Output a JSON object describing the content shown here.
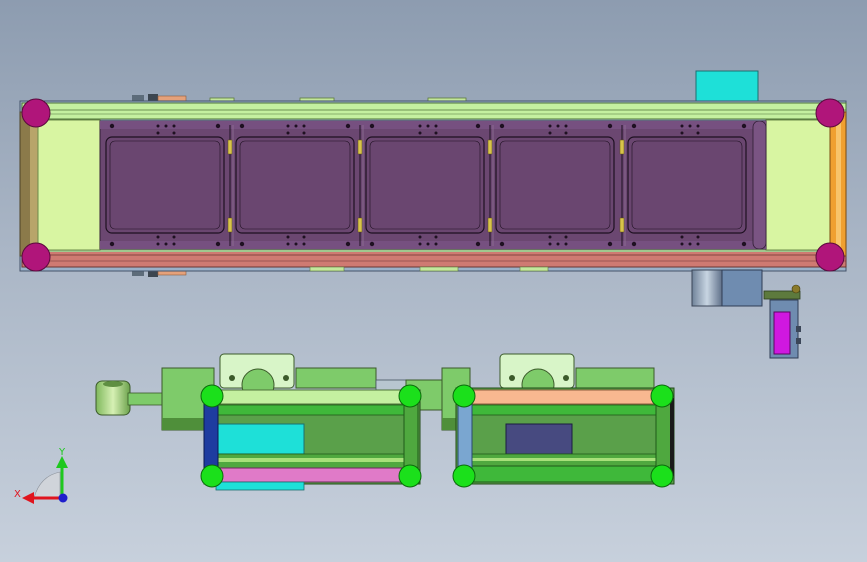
{
  "viewport": {
    "background_top": "#8d9cb0",
    "background_bottom": "#c7d0dc"
  },
  "triad": {
    "x_label": "X",
    "y_label": "Y",
    "x_color": "#e0141e",
    "y_color": "#1ec81e",
    "z_color": "#1e1ecc"
  },
  "colors": {
    "corner_magenta": "#b0157a",
    "corner_green": "#1be01b",
    "conveyor_belt": "#6b4771",
    "frame_lime": "#d8f5a2",
    "motor_cyan": "#1ee0d8",
    "belt_orange": "#f3a05b",
    "rail_pink": "#e07ac8"
  },
  "conveyor": {
    "pocket_count": 5
  }
}
